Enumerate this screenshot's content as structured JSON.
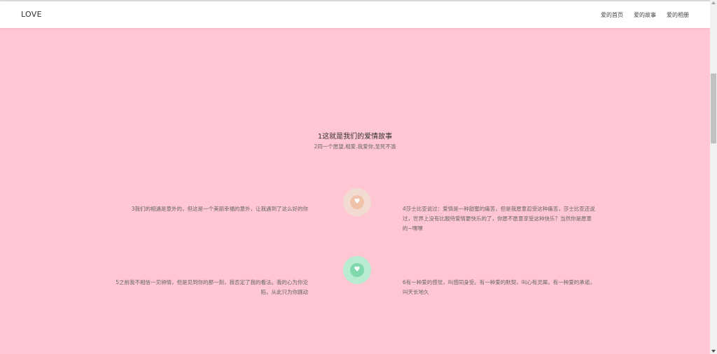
{
  "navbar": {
    "brand": "LOVE",
    "links": [
      "爱的首页",
      "爱的故事",
      "爱的相册"
    ]
  },
  "intro": {
    "title": "1这就是我们的爱情故事",
    "subtitle": "2同一个愿望,相爱.我爱你,至死不渝"
  },
  "timeline": [
    {
      "left_text": "3我们的相遇是意外的，但这是一个美丽幸福的意外，让我遇到了这么好的你",
      "right_text": "4莎士比亚说过：爱情是一种甜蜜的痛苦，但是我愿意忍受这种痛苦，莎士比亚还说过，世界上没有比服侍爱情更快乐的了，你愿不愿意享受这种快乐？当然你是愿意的~嘿嘿",
      "icon": "heart-icon",
      "color": "#f0c2a9"
    },
    {
      "left_text": "5之前我不相信一见钟情，但是见到你的那一刻，我否定了我的看法。我的心为你沦陷，从此只为你跳动",
      "right_text": "6有一种爱的感觉，叫感同身受。有一种爱的默契，叫心有灵犀。有一种爱的承诺，叫天长地久",
      "icon": "heart-icon",
      "color": "#7fd9ad"
    }
  ],
  "colors": {
    "background": "#ffc6d4",
    "navbar": "#ffffff"
  }
}
